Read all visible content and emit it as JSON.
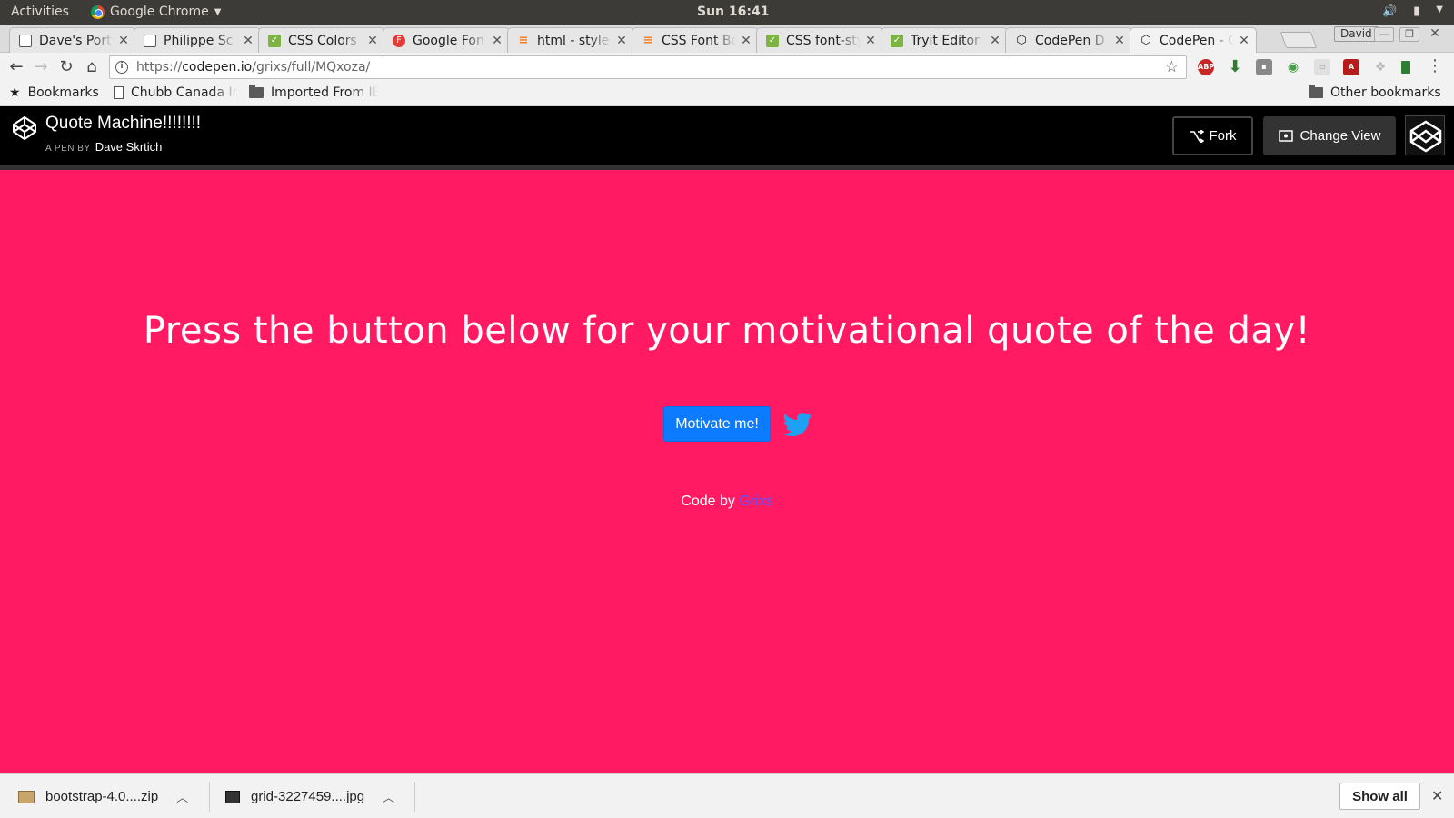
{
  "os_panel": {
    "activities": "Activities",
    "app_name": "Google Chrome",
    "clock": "Sun 16:41"
  },
  "tabs": [
    {
      "title": "Dave's Port",
      "favicon": "doc-icon"
    },
    {
      "title": "Philippe Sc",
      "favicon": "doc-icon"
    },
    {
      "title": "CSS Colors",
      "favicon": "w3schools-icon"
    },
    {
      "title": "Google Fon",
      "favicon": "google-fonts-icon"
    },
    {
      "title": "html - style",
      "favicon": "stackoverflow-icon"
    },
    {
      "title": "CSS Font Bo",
      "favicon": "stackoverflow-icon"
    },
    {
      "title": "CSS font-sty",
      "favicon": "w3schools-icon"
    },
    {
      "title": "Tryit Editor",
      "favicon": "w3schools-icon"
    },
    {
      "title": "CodePen D",
      "favicon": "codepen-icon"
    },
    {
      "title": "CodePen - C",
      "favicon": "codepen-icon",
      "active": true
    }
  ],
  "user_badge": "David",
  "address_bar": {
    "url_prefix": "https://",
    "url_host": "codepen.io",
    "url_path": "/grixs/full/MQxoza/"
  },
  "bookmarks": {
    "bookmarks_label": "Bookmarks",
    "item1": "Chubb Canada In",
    "item2": "Imported From IE",
    "other": "Other bookmarks"
  },
  "codepen": {
    "title": "Quote Machine!!!!!!!!",
    "byline_prefix": "A PEN BY",
    "author": "Dave Skrtich",
    "fork_label": "Fork",
    "change_view_label": "Change View"
  },
  "pen": {
    "headline": "Press the button below for your motivational quote of the day!",
    "button_label": "Motivate me!",
    "credit_prefix": "Code by ",
    "credit_link": "Grixs",
    "background_color": "#ff1a63",
    "button_color": "#0d7bff",
    "twitter_color": "#1da1f2"
  },
  "downloads": {
    "file1": "bootstrap-4.0....zip",
    "file2": "grid-3227459....jpg",
    "show_all": "Show all"
  }
}
